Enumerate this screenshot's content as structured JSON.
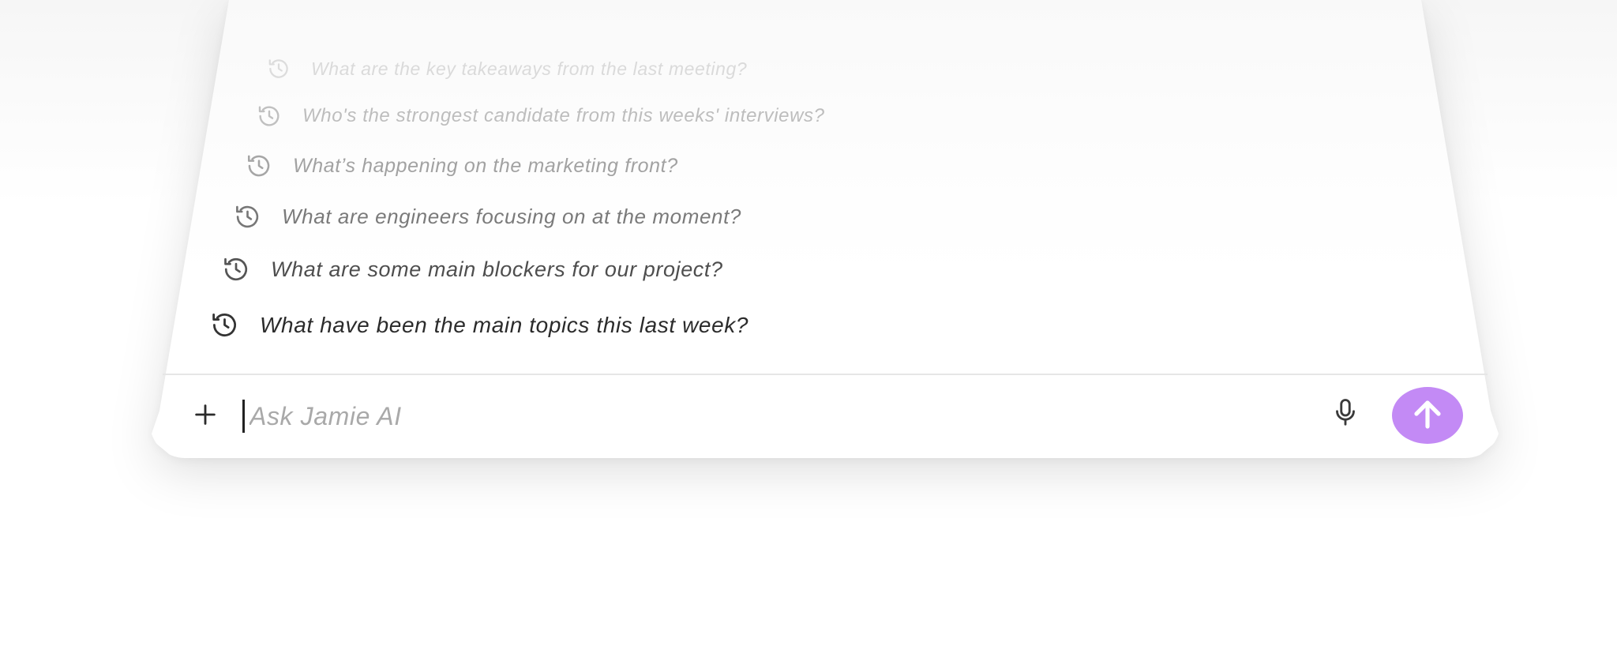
{
  "history": {
    "items": [
      {
        "label": "What are the key takeaways from the last meeting?",
        "icon": "history-icon"
      },
      {
        "label": "Who's the strongest candidate from this weeks' interviews?",
        "icon": "history-icon"
      },
      {
        "label": "What’s happening on the marketing front?",
        "icon": "history-icon"
      },
      {
        "label": "What are engineers focusing on at the moment?",
        "icon": "history-icon"
      },
      {
        "label": "What are some main blockers for our project?",
        "icon": "history-icon"
      },
      {
        "label": "What have been the main topics this last week?",
        "icon": "history-icon"
      }
    ]
  },
  "composer": {
    "placeholder": "Ask Jamie AI",
    "value": "",
    "add_icon": "plus-icon",
    "mic_icon": "microphone-icon",
    "send_icon": "arrow-up-icon"
  },
  "colors": {
    "send_button": "#c38af5",
    "text_primary": "#2b2b2b",
    "placeholder": "#a9a9a9"
  }
}
